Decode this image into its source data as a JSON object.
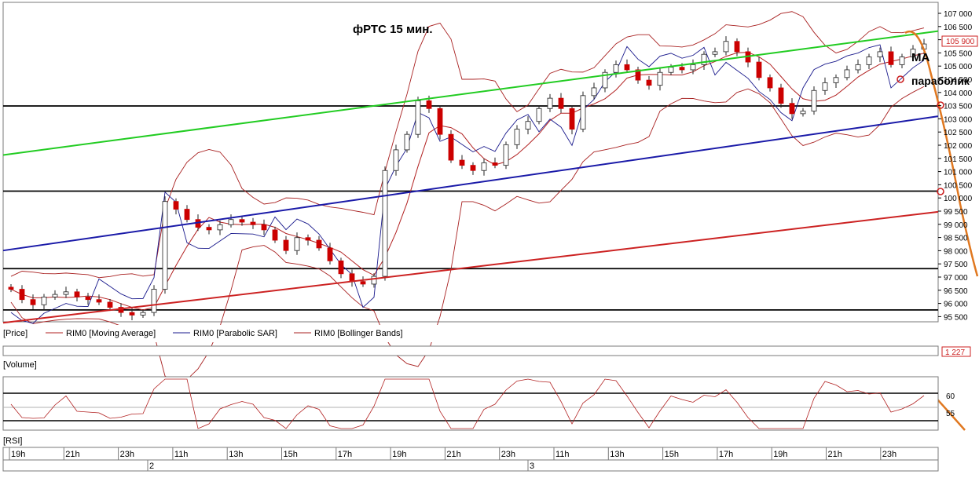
{
  "annotations": {
    "title": "фРТС   15 мин.",
    "ma_label": "МА",
    "sar_label": "параболик"
  },
  "price_panel": {
    "legend_price": "[Price]",
    "legend_ma": "RIM0 [Moving Average]",
    "legend_sar": "RIM0 [Parabolic SAR]",
    "legend_bb": "RIM0 [Bollinger Bands]",
    "last_price_label": "105 900",
    "price_axis_labels": [
      "107 000",
      "106 500",
      "106 000",
      "105 500",
      "105 000",
      "104 500",
      "104 000",
      "103 500",
      "103 000",
      "102 500",
      "102 000",
      "101 500",
      "101 000",
      "100 500",
      "100 000",
      "99 500",
      "99 000",
      "98 500",
      "98 000",
      "97 500",
      "97 000",
      "96 500",
      "96 000",
      "95 500"
    ]
  },
  "volume_panel": {
    "label": "[Volume]",
    "value_label": "1 227"
  },
  "rsi_panel": {
    "label": "[RSI]",
    "axis_labels": [
      "60",
      "55"
    ]
  },
  "time_axis": {
    "hour_labels": [
      "19h",
      "21h",
      "23h",
      "11h",
      "13h",
      "15h",
      "17h",
      "19h",
      "21h",
      "23h",
      "11h",
      "13h",
      "15h",
      "17h",
      "19h",
      "21h",
      "23h"
    ],
    "day_labels": [
      "2",
      "3"
    ]
  },
  "colors": {
    "candle_up": "#ffffff",
    "candle_down": "#cc0000",
    "ma": "#b22222",
    "sar": "#1a1a8c",
    "bollinger": "#a82020",
    "green_line": "#22cc22",
    "blue_line": "#1a1aa8",
    "red_line": "#cc2222",
    "forecast": "#e07820",
    "grid_line": "#000000"
  },
  "chart_data": {
    "type": "candlestick",
    "title": "фРТС   15 мин.",
    "ylim": [
      95200,
      107300
    ],
    "horizontal_levels": [
      103500,
      100200,
      97200,
      95600
    ],
    "trendlines": [
      {
        "name": "green",
        "from_price": 101600,
        "to_price": 106400
      },
      {
        "name": "blue",
        "from_price": 97900,
        "to_price": 103100
      },
      {
        "name": "red",
        "from_price": 95100,
        "to_price": 99400
      }
    ],
    "close_path": [
      96400,
      96000,
      95800,
      96100,
      96200,
      96300,
      96100,
      96000,
      95900,
      95700,
      95500,
      95400,
      95500,
      96400,
      99800,
      99500,
      99100,
      98800,
      98700,
      98900,
      99100,
      99000,
      98900,
      98700,
      98300,
      97900,
      98400,
      98300,
      98000,
      97500,
      97000,
      96700,
      96600,
      96900,
      101000,
      101800,
      102400,
      103700,
      103400,
      102400,
      101400,
      101200,
      101000,
      101300,
      101200,
      102000,
      102600,
      102900,
      103400,
      103800,
      103400,
      102600,
      103900,
      104200,
      104800,
      105100,
      104900,
      104500,
      104300,
      104800,
      105000,
      104900,
      105100,
      105500,
      105600,
      106000,
      105600,
      105200,
      104600,
      104200,
      103600,
      103200,
      103300,
      104100,
      104400,
      104600,
      104900,
      105100,
      105400,
      105600,
      105100,
      105400,
      105700,
      105900
    ]
  }
}
